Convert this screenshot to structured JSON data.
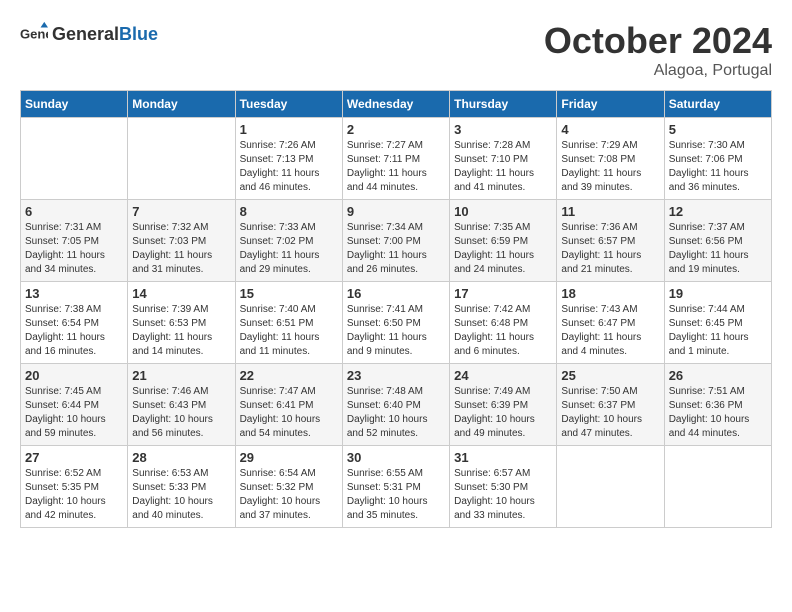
{
  "header": {
    "logo_general": "General",
    "logo_blue": "Blue",
    "month": "October 2024",
    "location": "Alagoa, Portugal"
  },
  "columns": [
    "Sunday",
    "Monday",
    "Tuesday",
    "Wednesday",
    "Thursday",
    "Friday",
    "Saturday"
  ],
  "weeks": [
    [
      {
        "day": "",
        "sunrise": "",
        "sunset": "",
        "daylight": ""
      },
      {
        "day": "",
        "sunrise": "",
        "sunset": "",
        "daylight": ""
      },
      {
        "day": "1",
        "sunrise": "Sunrise: 7:26 AM",
        "sunset": "Sunset: 7:13 PM",
        "daylight": "Daylight: 11 hours and 46 minutes."
      },
      {
        "day": "2",
        "sunrise": "Sunrise: 7:27 AM",
        "sunset": "Sunset: 7:11 PM",
        "daylight": "Daylight: 11 hours and 44 minutes."
      },
      {
        "day": "3",
        "sunrise": "Sunrise: 7:28 AM",
        "sunset": "Sunset: 7:10 PM",
        "daylight": "Daylight: 11 hours and 41 minutes."
      },
      {
        "day": "4",
        "sunrise": "Sunrise: 7:29 AM",
        "sunset": "Sunset: 7:08 PM",
        "daylight": "Daylight: 11 hours and 39 minutes."
      },
      {
        "day": "5",
        "sunrise": "Sunrise: 7:30 AM",
        "sunset": "Sunset: 7:06 PM",
        "daylight": "Daylight: 11 hours and 36 minutes."
      }
    ],
    [
      {
        "day": "6",
        "sunrise": "Sunrise: 7:31 AM",
        "sunset": "Sunset: 7:05 PM",
        "daylight": "Daylight: 11 hours and 34 minutes."
      },
      {
        "day": "7",
        "sunrise": "Sunrise: 7:32 AM",
        "sunset": "Sunset: 7:03 PM",
        "daylight": "Daylight: 11 hours and 31 minutes."
      },
      {
        "day": "8",
        "sunrise": "Sunrise: 7:33 AM",
        "sunset": "Sunset: 7:02 PM",
        "daylight": "Daylight: 11 hours and 29 minutes."
      },
      {
        "day": "9",
        "sunrise": "Sunrise: 7:34 AM",
        "sunset": "Sunset: 7:00 PM",
        "daylight": "Daylight: 11 hours and 26 minutes."
      },
      {
        "day": "10",
        "sunrise": "Sunrise: 7:35 AM",
        "sunset": "Sunset: 6:59 PM",
        "daylight": "Daylight: 11 hours and 24 minutes."
      },
      {
        "day": "11",
        "sunrise": "Sunrise: 7:36 AM",
        "sunset": "Sunset: 6:57 PM",
        "daylight": "Daylight: 11 hours and 21 minutes."
      },
      {
        "day": "12",
        "sunrise": "Sunrise: 7:37 AM",
        "sunset": "Sunset: 6:56 PM",
        "daylight": "Daylight: 11 hours and 19 minutes."
      }
    ],
    [
      {
        "day": "13",
        "sunrise": "Sunrise: 7:38 AM",
        "sunset": "Sunset: 6:54 PM",
        "daylight": "Daylight: 11 hours and 16 minutes."
      },
      {
        "day": "14",
        "sunrise": "Sunrise: 7:39 AM",
        "sunset": "Sunset: 6:53 PM",
        "daylight": "Daylight: 11 hours and 14 minutes."
      },
      {
        "day": "15",
        "sunrise": "Sunrise: 7:40 AM",
        "sunset": "Sunset: 6:51 PM",
        "daylight": "Daylight: 11 hours and 11 minutes."
      },
      {
        "day": "16",
        "sunrise": "Sunrise: 7:41 AM",
        "sunset": "Sunset: 6:50 PM",
        "daylight": "Daylight: 11 hours and 9 minutes."
      },
      {
        "day": "17",
        "sunrise": "Sunrise: 7:42 AM",
        "sunset": "Sunset: 6:48 PM",
        "daylight": "Daylight: 11 hours and 6 minutes."
      },
      {
        "day": "18",
        "sunrise": "Sunrise: 7:43 AM",
        "sunset": "Sunset: 6:47 PM",
        "daylight": "Daylight: 11 hours and 4 minutes."
      },
      {
        "day": "19",
        "sunrise": "Sunrise: 7:44 AM",
        "sunset": "Sunset: 6:45 PM",
        "daylight": "Daylight: 11 hours and 1 minute."
      }
    ],
    [
      {
        "day": "20",
        "sunrise": "Sunrise: 7:45 AM",
        "sunset": "Sunset: 6:44 PM",
        "daylight": "Daylight: 10 hours and 59 minutes."
      },
      {
        "day": "21",
        "sunrise": "Sunrise: 7:46 AM",
        "sunset": "Sunset: 6:43 PM",
        "daylight": "Daylight: 10 hours and 56 minutes."
      },
      {
        "day": "22",
        "sunrise": "Sunrise: 7:47 AM",
        "sunset": "Sunset: 6:41 PM",
        "daylight": "Daylight: 10 hours and 54 minutes."
      },
      {
        "day": "23",
        "sunrise": "Sunrise: 7:48 AM",
        "sunset": "Sunset: 6:40 PM",
        "daylight": "Daylight: 10 hours and 52 minutes."
      },
      {
        "day": "24",
        "sunrise": "Sunrise: 7:49 AM",
        "sunset": "Sunset: 6:39 PM",
        "daylight": "Daylight: 10 hours and 49 minutes."
      },
      {
        "day": "25",
        "sunrise": "Sunrise: 7:50 AM",
        "sunset": "Sunset: 6:37 PM",
        "daylight": "Daylight: 10 hours and 47 minutes."
      },
      {
        "day": "26",
        "sunrise": "Sunrise: 7:51 AM",
        "sunset": "Sunset: 6:36 PM",
        "daylight": "Daylight: 10 hours and 44 minutes."
      }
    ],
    [
      {
        "day": "27",
        "sunrise": "Sunrise: 6:52 AM",
        "sunset": "Sunset: 5:35 PM",
        "daylight": "Daylight: 10 hours and 42 minutes."
      },
      {
        "day": "28",
        "sunrise": "Sunrise: 6:53 AM",
        "sunset": "Sunset: 5:33 PM",
        "daylight": "Daylight: 10 hours and 40 minutes."
      },
      {
        "day": "29",
        "sunrise": "Sunrise: 6:54 AM",
        "sunset": "Sunset: 5:32 PM",
        "daylight": "Daylight: 10 hours and 37 minutes."
      },
      {
        "day": "30",
        "sunrise": "Sunrise: 6:55 AM",
        "sunset": "Sunset: 5:31 PM",
        "daylight": "Daylight: 10 hours and 35 minutes."
      },
      {
        "day": "31",
        "sunrise": "Sunrise: 6:57 AM",
        "sunset": "Sunset: 5:30 PM",
        "daylight": "Daylight: 10 hours and 33 minutes."
      },
      {
        "day": "",
        "sunrise": "",
        "sunset": "",
        "daylight": ""
      },
      {
        "day": "",
        "sunrise": "",
        "sunset": "",
        "daylight": ""
      }
    ]
  ]
}
